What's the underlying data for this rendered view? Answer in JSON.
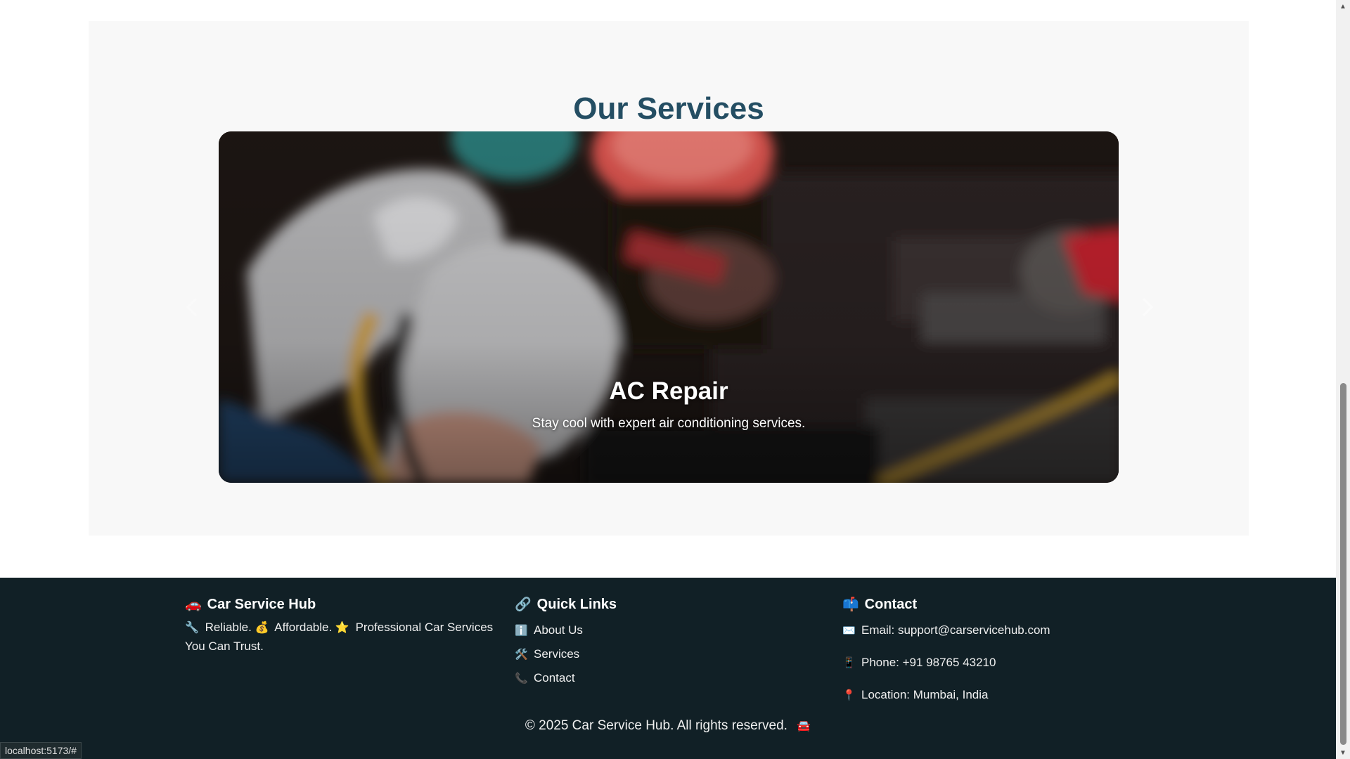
{
  "services": {
    "title": "Our Services",
    "slide": {
      "title": "AC Repair",
      "description": "Stay cool with expert air conditioning services."
    }
  },
  "footer": {
    "brand": {
      "icon": "🚗",
      "heading": "Car Service Hub",
      "tag1_icon": "🔧",
      "tag1": "Reliable.",
      "tag2_icon": "💰",
      "tag2": "Affordable.",
      "tag3_icon": "⭐",
      "tag3": "Professional Car Services You Can Trust."
    },
    "links": {
      "icon": "🔗",
      "heading": "Quick Links",
      "items": [
        {
          "icon": "ℹ️",
          "label": "About Us"
        },
        {
          "icon": "🛠️",
          "label": "Services"
        },
        {
          "icon": "📞",
          "label": "Contact"
        }
      ]
    },
    "contact": {
      "icon": "📫",
      "heading": "Contact",
      "email_icon": "✉️",
      "email_label": "Email:",
      "email": "support@carservicehub.com",
      "phone_icon": "📱",
      "phone": "Phone: +91 98765 43210",
      "location_icon": "📍",
      "location": "Location: Mumbai, India"
    },
    "copyright": "© 2025 Car Service Hub. All rights reserved.",
    "copyright_icon": "🚘"
  },
  "statusbar": {
    "url": "localhost:5173/#"
  },
  "colors": {
    "title": "#244e63",
    "footer_bg": "#112026",
    "section_bg": "#f8f8f8"
  }
}
